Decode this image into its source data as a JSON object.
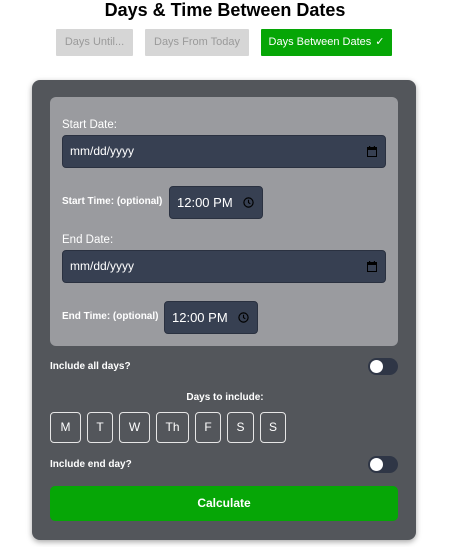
{
  "page": {
    "title": "Days & Time Between Dates"
  },
  "tabs": [
    {
      "label": "Days Until..."
    },
    {
      "label": "Days From Today"
    },
    {
      "label": "Days Between Dates",
      "check": "✓"
    }
  ],
  "form": {
    "start_date_label": "Start Date:",
    "start_date_value": "mm/dd/yyyy",
    "start_time_label": "Start Time: (optional)",
    "start_time_value": "12:00 PM",
    "end_date_label": "End Date:",
    "end_date_value": "mm/dd/yyyy",
    "end_time_label": "End Time: (optional)",
    "end_time_value": "12:00 PM"
  },
  "options": {
    "include_all_days_label": "Include all days?",
    "include_all_days_on": false,
    "days_to_include_label": "Days to include:",
    "days": [
      "M",
      "T",
      "W",
      "Th",
      "F",
      "S",
      "S"
    ],
    "include_end_day_label": "Include end day?",
    "include_end_day_on": false
  },
  "actions": {
    "calculate_label": "Calculate"
  },
  "colors": {
    "accent": "#06a606",
    "card": "#53565b",
    "panel": "#9a9b9f",
    "field": "#374052"
  }
}
